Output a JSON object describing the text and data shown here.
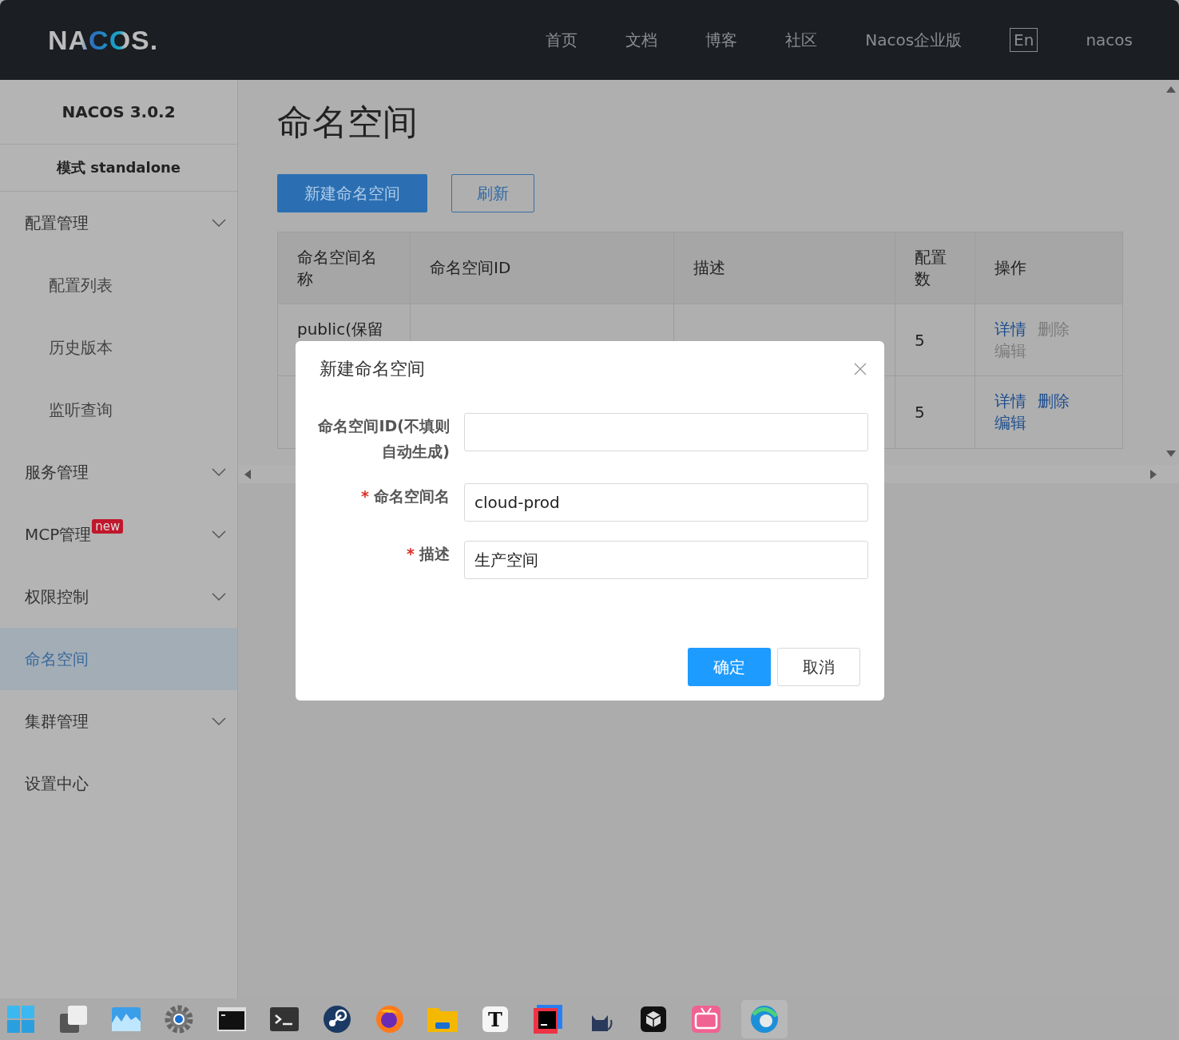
{
  "header": {
    "logo": "NACOS.",
    "nav": [
      {
        "label": "首页",
        "kind": "link"
      },
      {
        "label": "文档",
        "kind": "link"
      },
      {
        "label": "博客",
        "kind": "link"
      },
      {
        "label": "社区",
        "kind": "link"
      },
      {
        "label": "Nacos企业版",
        "kind": "link"
      },
      {
        "label": "En",
        "kind": "boxed"
      },
      {
        "label": "nacos",
        "kind": "link"
      }
    ]
  },
  "sidebar": {
    "version": "NACOS 3.0.2",
    "mode": "模式 standalone",
    "items": [
      {
        "label": "配置管理",
        "selected": false,
        "kind": "group",
        "children": [
          {
            "label": "配置列表",
            "selected": false
          },
          {
            "label": "历史版本",
            "selected": false
          },
          {
            "label": "监听查询",
            "selected": false
          }
        ]
      },
      {
        "label": "服务管理",
        "selected": false,
        "kind": "group"
      },
      {
        "label": "MCP管理",
        "badge": "new",
        "selected": false,
        "kind": "group"
      },
      {
        "label": "权限控制",
        "selected": false,
        "kind": "group"
      },
      {
        "label": "命名空间",
        "selected": true,
        "kind": "link"
      },
      {
        "label": "集群管理",
        "selected": false,
        "kind": "group"
      },
      {
        "label": "设置中心",
        "selected": false,
        "kind": "link"
      }
    ]
  },
  "page": {
    "title": "命名空间",
    "buttons": [
      {
        "label": "新建命名空间",
        "kind": "primary"
      },
      {
        "label": "刷新",
        "kind": "secondary"
      }
    ]
  },
  "table": {
    "columns": [
      "命名空间名称",
      "命名空间ID",
      "描述",
      "配置数",
      "操作"
    ],
    "rows": [
      {
        "name": "public(保留",
        "count": "5",
        "actions": [
          {
            "label": "详情",
            "disabled": false
          },
          {
            "label": "删除",
            "disabled": true
          },
          {
            "label": "编辑",
            "disabled": true
          }
        ]
      },
      {
        "count": "5",
        "actions": [
          {
            "label": "详情",
            "disabled": false
          },
          {
            "label": "删除",
            "disabled": false
          },
          {
            "label": "编辑",
            "disabled": false
          }
        ]
      }
    ]
  },
  "dialog": {
    "title": "新建命名空间",
    "fields": [
      {
        "label": "命名空间ID(不填则自动生成)"
      },
      {
        "label": "命名空间名",
        "required_mark": "*",
        "value": "cloud-prod"
      },
      {
        "label": "描述",
        "required_mark": "*",
        "value": "生产空间"
      }
    ],
    "buttons": [
      {
        "label": "确定",
        "kind": "primary"
      },
      {
        "label": "取消",
        "kind": "secondary"
      }
    ]
  },
  "taskbar": [
    {
      "kind": "start",
      "selected": false
    },
    {
      "kind": "windows",
      "selected": false
    },
    {
      "kind": "wave",
      "selected": false
    },
    {
      "kind": "gear",
      "selected": false
    },
    {
      "kind": "console",
      "selected": false
    },
    {
      "kind": "terminal",
      "selected": false
    },
    {
      "kind": "round",
      "selected": false
    },
    {
      "kind": "fox",
      "selected": false
    },
    {
      "kind": "folder",
      "selected": false
    },
    {
      "kind": "letter",
      "label": "T",
      "selected": false
    },
    {
      "kind": "ide",
      "selected": false
    },
    {
      "kind": "cat",
      "selected": false
    },
    {
      "kind": "cube",
      "selected": false
    },
    {
      "kind": "tv",
      "selected": false
    },
    {
      "kind": "swirl",
      "selected": true
    }
  ]
}
